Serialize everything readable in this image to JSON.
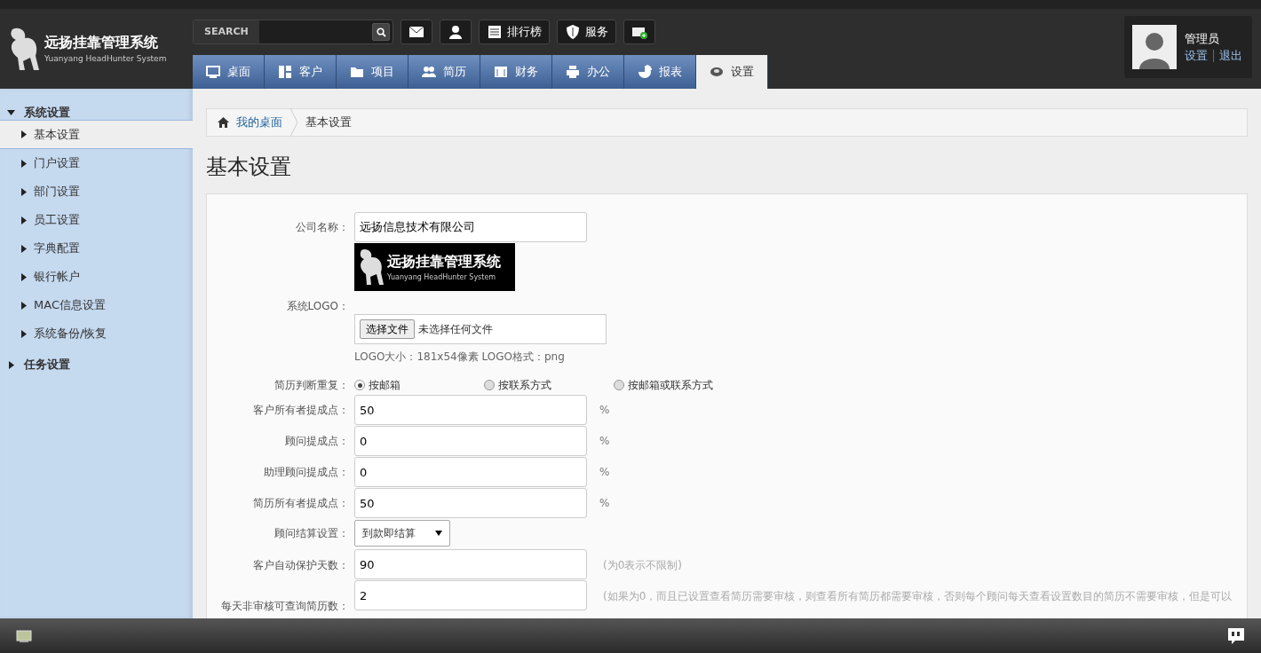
{
  "brand": {
    "title": "远扬挂靠管理系统",
    "subtitle": "Yuanyang HeadHunter System"
  },
  "search": {
    "label": "SEARCH"
  },
  "toolbar": [
    {
      "label": "排行榜"
    },
    {
      "label": "服务"
    }
  ],
  "tabs": [
    {
      "label": "桌面",
      "selected": false
    },
    {
      "label": "客户",
      "selected": false
    },
    {
      "label": "项目",
      "selected": false
    },
    {
      "label": "简历",
      "selected": false
    },
    {
      "label": "财务",
      "selected": false
    },
    {
      "label": "办公",
      "selected": false
    },
    {
      "label": "报表",
      "selected": false
    },
    {
      "label": "设置",
      "selected": true
    }
  ],
  "user": {
    "name": "管理员",
    "links": [
      "设置",
      "退出"
    ]
  },
  "sidebar": [
    {
      "label": "系统设置",
      "expanded": true,
      "children": [
        {
          "label": "基本设置",
          "selected": true
        },
        {
          "label": "门户设置",
          "selected": false
        },
        {
          "label": "部门设置",
          "selected": false
        },
        {
          "label": "员工设置",
          "selected": false
        },
        {
          "label": "字典配置",
          "selected": false
        },
        {
          "label": "银行帐户",
          "selected": false
        },
        {
          "label": "MAC信息设置",
          "selected": false
        },
        {
          "label": "系统备份/恢复",
          "selected": false
        }
      ]
    },
    {
      "label": "任务设置",
      "expanded": false
    }
  ],
  "breadcrumb": [
    "我的桌面",
    "基本设置"
  ],
  "page_title": "基本设置",
  "form": [
    {
      "kind": "text",
      "label": "公司名称：",
      "value": "远扬信息技术有限公司"
    },
    {
      "kind": "logo",
      "label": "系统LOGO：",
      "logo": {
        "title": "远扬挂靠管理系统",
        "subtitle": "Yuanyang HeadHunter System"
      },
      "button": "选择文件",
      "status": "未选择任何文件",
      "hint": "LOGO大小：181x54像素 LOGO格式：png"
    },
    {
      "kind": "radio",
      "label": "简历判断重复：",
      "options": [
        {
          "label": "按邮箱",
          "selected": true
        },
        {
          "label": "按联系方式",
          "selected": false
        },
        {
          "label": "按邮箱或联系方式",
          "selected": false
        }
      ]
    },
    {
      "kind": "text",
      "label": "客户所有者提成点：",
      "value": "50",
      "suffix": "%"
    },
    {
      "kind": "text",
      "label": "顾问提成点：",
      "value": "0",
      "suffix": "%"
    },
    {
      "kind": "text",
      "label": "助理顾问提成点：",
      "value": "0",
      "suffix": "%"
    },
    {
      "kind": "text",
      "label": "简历所有者提成点：",
      "value": "50",
      "suffix": "%"
    },
    {
      "kind": "select",
      "label": "顾问结算设置：",
      "value": "到款即结算"
    },
    {
      "kind": "text",
      "label": "客户自动保护天数：",
      "value": "90",
      "note": "(为0表示不限制)"
    },
    {
      "kind": "text",
      "label": "每天非审核可查询简历数：",
      "value": "2",
      "note": "(如果为0，而且已设置查看简历需要审核，则查看所有简历都需要审核，否则每个顾问每天查看设置数目的简历不需要审核，但是可以"
    }
  ]
}
